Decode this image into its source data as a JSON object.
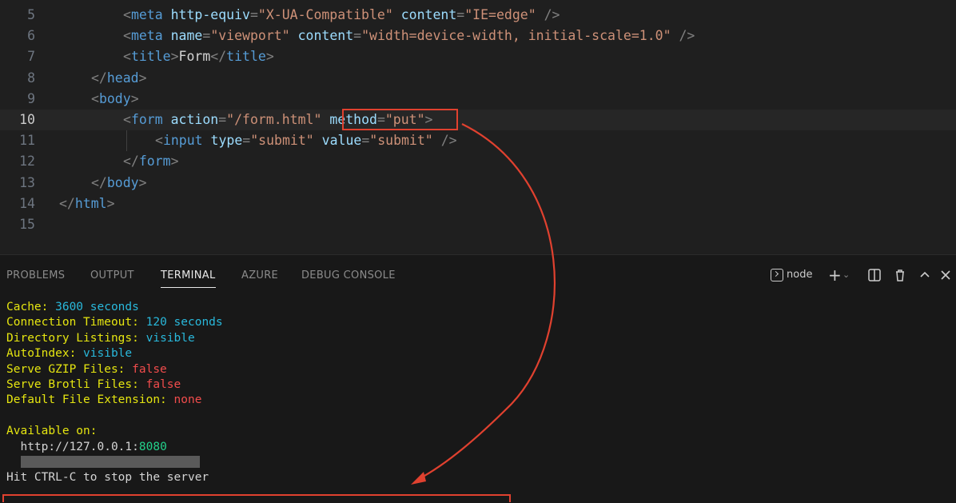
{
  "editor": {
    "lines": [
      {
        "num": "5",
        "indent": 4,
        "tokens": [
          [
            "punct",
            "<"
          ],
          [
            "tag",
            "meta"
          ],
          [
            "txt",
            " "
          ],
          [
            "attr",
            "http-equiv"
          ],
          [
            "punct",
            "="
          ],
          [
            "str",
            "\"X-UA-Compatible\""
          ],
          [
            "txt",
            " "
          ],
          [
            "attr",
            "content"
          ],
          [
            "punct",
            "="
          ],
          [
            "str",
            "\"IE=edge\""
          ],
          [
            "txt",
            " "
          ],
          [
            "punct",
            "/>"
          ]
        ]
      },
      {
        "num": "6",
        "indent": 4,
        "tokens": [
          [
            "punct",
            "<"
          ],
          [
            "tag",
            "meta"
          ],
          [
            "txt",
            " "
          ],
          [
            "attr",
            "name"
          ],
          [
            "punct",
            "="
          ],
          [
            "str",
            "\"viewport\""
          ],
          [
            "txt",
            " "
          ],
          [
            "attr",
            "content"
          ],
          [
            "punct",
            "="
          ],
          [
            "str",
            "\"width=device-width, initial-scale=1.0\""
          ],
          [
            "txt",
            " "
          ],
          [
            "punct",
            "/>"
          ]
        ]
      },
      {
        "num": "7",
        "indent": 4,
        "tokens": [
          [
            "punct",
            "<"
          ],
          [
            "tag",
            "title"
          ],
          [
            "punct",
            ">"
          ],
          [
            "txt",
            "Form"
          ],
          [
            "punct",
            "</"
          ],
          [
            "tag",
            "title"
          ],
          [
            "punct",
            ">"
          ]
        ]
      },
      {
        "num": "8",
        "indent": 2,
        "tokens": [
          [
            "punct",
            "</"
          ],
          [
            "tag",
            "head"
          ],
          [
            "punct",
            ">"
          ]
        ]
      },
      {
        "num": "9",
        "indent": 2,
        "tokens": [
          [
            "punct",
            "<"
          ],
          [
            "tag",
            "body"
          ],
          [
            "punct",
            ">"
          ]
        ]
      },
      {
        "num": "10",
        "indent": 4,
        "active": true,
        "tokens": [
          [
            "punct",
            "<"
          ],
          [
            "tag",
            "form"
          ],
          [
            "txt",
            " "
          ],
          [
            "attr",
            "action"
          ],
          [
            "punct",
            "="
          ],
          [
            "str",
            "\"/form.html\""
          ],
          [
            "txt",
            " "
          ],
          [
            "attr",
            "method"
          ],
          [
            "punct",
            "="
          ],
          [
            "str",
            "\"put\""
          ],
          [
            "punct",
            ">"
          ]
        ]
      },
      {
        "num": "11",
        "indent": 6,
        "tokens": [
          [
            "punct",
            "<"
          ],
          [
            "tag",
            "input"
          ],
          [
            "txt",
            " "
          ],
          [
            "attr",
            "type"
          ],
          [
            "punct",
            "="
          ],
          [
            "str",
            "\"submit\""
          ],
          [
            "txt",
            " "
          ],
          [
            "attr",
            "value"
          ],
          [
            "punct",
            "="
          ],
          [
            "str",
            "\"submit\""
          ],
          [
            "txt",
            " "
          ],
          [
            "punct",
            "/>"
          ]
        ]
      },
      {
        "num": "12",
        "indent": 4,
        "tokens": [
          [
            "punct",
            "</"
          ],
          [
            "tag",
            "form"
          ],
          [
            "punct",
            ">"
          ]
        ]
      },
      {
        "num": "13",
        "indent": 2,
        "tokens": [
          [
            "punct",
            "</"
          ],
          [
            "tag",
            "body"
          ],
          [
            "punct",
            ">"
          ]
        ]
      },
      {
        "num": "14",
        "indent": 0,
        "tokens": [
          [
            "punct",
            "</"
          ],
          [
            "tag",
            "html"
          ],
          [
            "punct",
            ">"
          ]
        ]
      },
      {
        "num": "15",
        "indent": 0,
        "tokens": []
      }
    ]
  },
  "panel": {
    "tabs": [
      {
        "label": "PROBLEMS",
        "active": false
      },
      {
        "label": "OUTPUT",
        "active": false
      },
      {
        "label": "TERMINAL",
        "active": true
      },
      {
        "label": "AZURE",
        "active": false
      },
      {
        "label": "DEBUG CONSOLE",
        "active": false
      }
    ],
    "shell_name": "node",
    "icons": [
      "terminal-icon",
      "add-icon",
      "chevron-down-icon",
      "split-icon",
      "trash-icon",
      "chevron-up-icon",
      "close-icon"
    ]
  },
  "terminal": {
    "lines": [
      [
        [
          "ty",
          "Cache: "
        ],
        [
          "tc",
          "3600 seconds"
        ]
      ],
      [
        [
          "ty",
          "Connection Timeout: "
        ],
        [
          "tc",
          "120 seconds"
        ]
      ],
      [
        [
          "ty",
          "Directory Listings: "
        ],
        [
          "tc",
          "visible"
        ]
      ],
      [
        [
          "ty",
          "AutoIndex: "
        ],
        [
          "tc",
          "visible"
        ]
      ],
      [
        [
          "ty",
          "Serve GZIP Files: "
        ],
        [
          "tr",
          "false"
        ]
      ],
      [
        [
          "ty",
          "Serve Brotli Files: "
        ],
        [
          "tr",
          "false"
        ]
      ],
      [
        [
          "ty",
          "Default File Extension: "
        ],
        [
          "tr",
          "none"
        ]
      ],
      [],
      [
        [
          "ty",
          "Available on:"
        ]
      ],
      [
        [
          "tw",
          "  http://127.0.0.1:"
        ],
        [
          "tg",
          "8080"
        ]
      ],
      [
        "SELECTION"
      ],
      [
        [
          "tw",
          "Hit CTRL-C to stop the server"
        ]
      ]
    ]
  },
  "colors": {
    "annotation": "#e0412f",
    "editor_bg": "#1f1f1f",
    "panel_bg": "#181818"
  }
}
